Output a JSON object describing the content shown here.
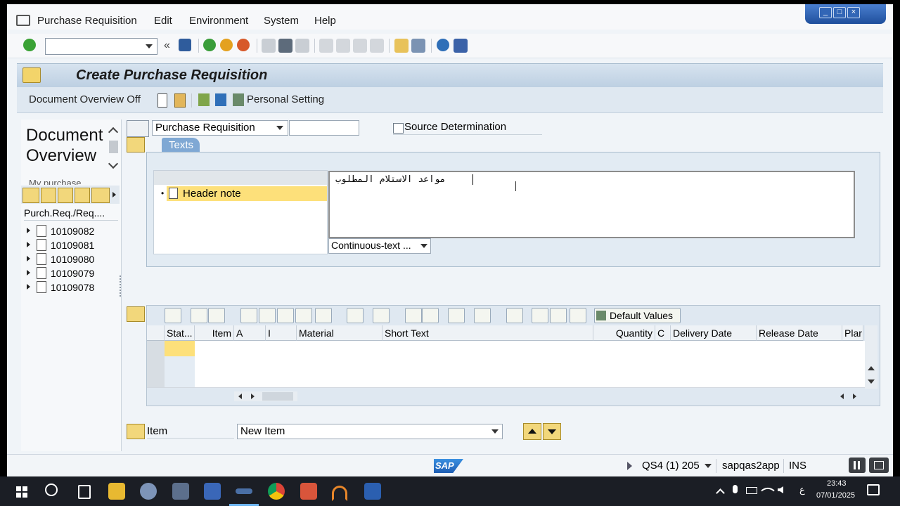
{
  "menu": {
    "items": [
      "Purchase Requisition",
      "Edit",
      "Environment",
      "System",
      "Help"
    ]
  },
  "window_controls": [
    "_",
    "□",
    "×"
  ],
  "title": "Create Purchase Requisition",
  "app_toolbar": {
    "doc_overview": "Document Overview Off",
    "personal_setting": "Personal Setting"
  },
  "left_panel": {
    "title_line1": "Document",
    "title_line2": "Overview",
    "subtitle": "My purchase",
    "column_header": "Purch.Req./Req....",
    "items": [
      "10109082",
      "10109081",
      "10109080",
      "10109079",
      "10109078"
    ]
  },
  "header": {
    "doc_type": "Purchase Requisition",
    "doc_number": "",
    "source_determination": "Source Determination",
    "source_determination_checked": false
  },
  "texts_tab": {
    "label": "Texts",
    "tree_item": "Header note",
    "editor_text": "مواعد الاستلام المطلوب",
    "format": "Continuous-text ..."
  },
  "grid": {
    "default_values": "Default Values",
    "columns": [
      "Stat...",
      "Item",
      "A",
      "I",
      "Material",
      "Short Text",
      "Quantity",
      "C",
      "Delivery Date",
      "Release Date",
      "Plar"
    ],
    "rows": 3
  },
  "item_bar": {
    "label": "Item",
    "selection": "New Item"
  },
  "status_bar": {
    "system": "QS4 (1) 205",
    "server": "sapqas2app",
    "mode": "INS",
    "logo": "SAP"
  },
  "taskbar": {
    "time": "23:43",
    "date": "07/01/2025",
    "lang": "ع"
  },
  "colors": {
    "selection": "#fde07a",
    "accent_blue": "#2b5fb0",
    "tab_blue": "#7fa8d4"
  }
}
